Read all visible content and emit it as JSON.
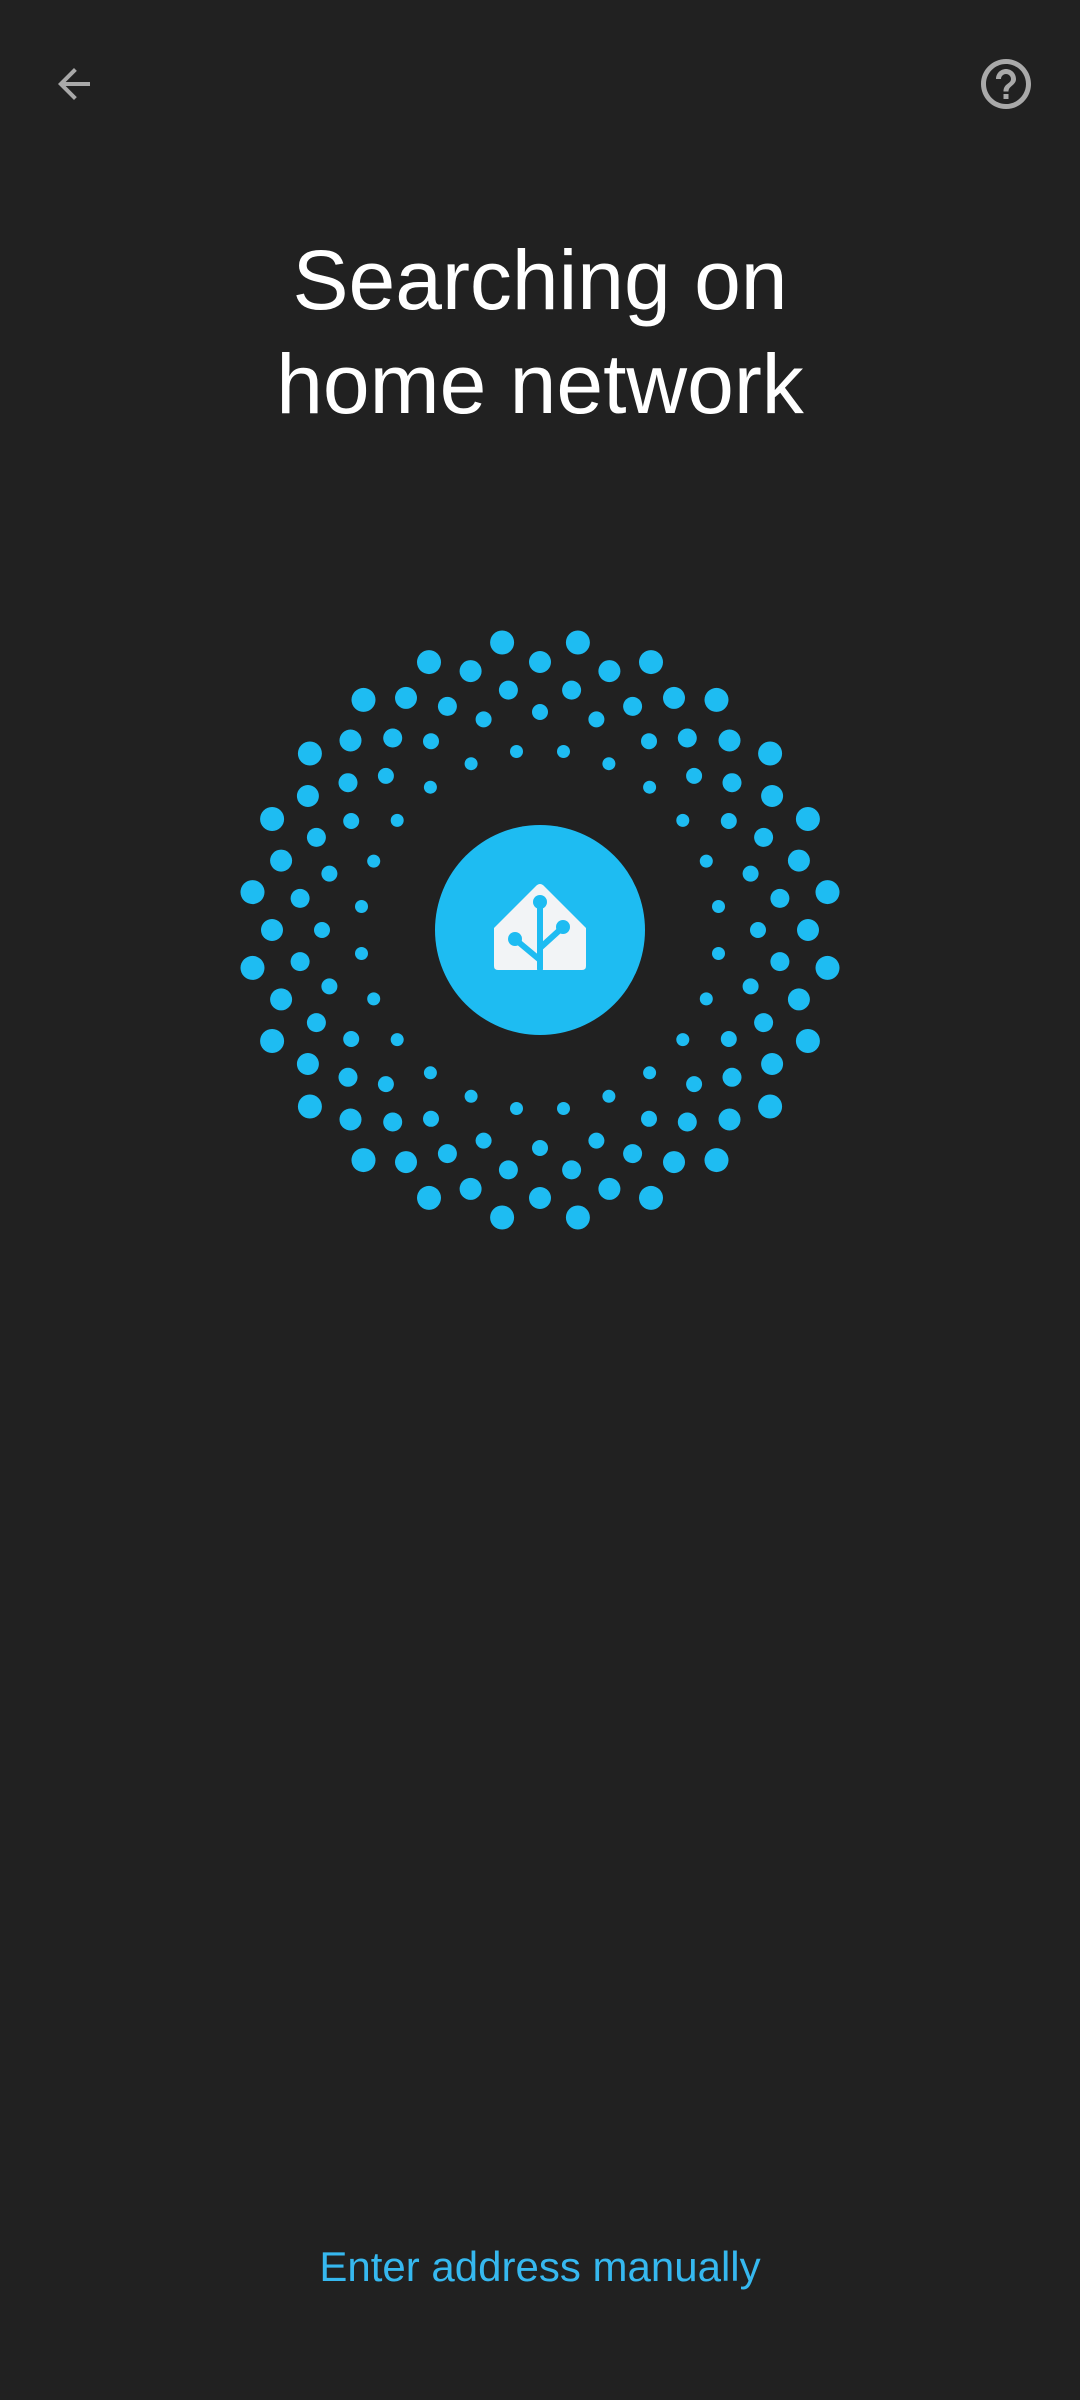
{
  "header": {
    "back_icon": "arrow-back-icon",
    "help_icon": "help-circle-icon"
  },
  "title": {
    "line1": "Searching on",
    "line2": "home network"
  },
  "graphic": {
    "logo_icon": "home-assistant-logo-icon",
    "accent_color": "#1ebcf2"
  },
  "footer": {
    "manual_link_label": "Enter address manually"
  },
  "colors": {
    "background": "#212121",
    "accent": "#1ebcf2",
    "link": "#36b8ef",
    "icon_gray": "#a9a9a9"
  }
}
